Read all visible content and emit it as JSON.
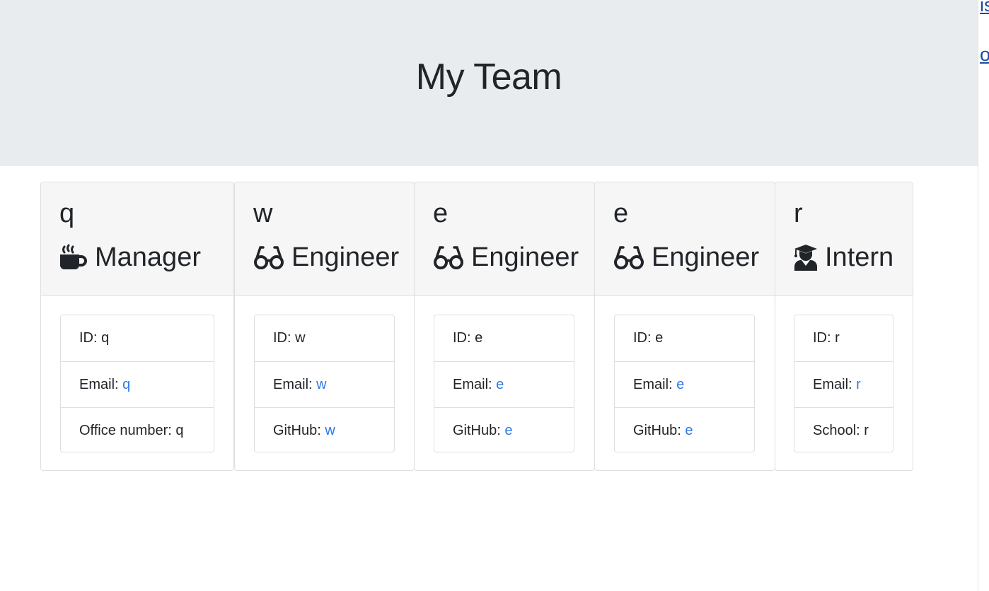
{
  "header": {
    "title": "My Team"
  },
  "right_strip": {
    "top_fragment": "is",
    "bottom_fragment": "or"
  },
  "colors": {
    "jumbotron_bg": "#e9ecef",
    "link": "#2f79e8",
    "card_header_bg": "#f6f6f6"
  },
  "cards": [
    {
      "name": "q",
      "role": "Manager",
      "role_icon": "mug-hot-icon",
      "id_label": "ID: ",
      "id": "q",
      "email_label": "Email: ",
      "email": "q",
      "extra_label": "Office number: ",
      "extra": "q",
      "extra_is_link": false
    },
    {
      "name": "w",
      "role": "Engineer",
      "role_icon": "glasses-icon",
      "id_label": "ID: ",
      "id": "w",
      "email_label": "Email: ",
      "email": "w",
      "extra_label": "GitHub: ",
      "extra": "w",
      "extra_is_link": true
    },
    {
      "name": "e",
      "role": "Engineer",
      "role_icon": "glasses-icon",
      "id_label": "ID: ",
      "id": "e",
      "email_label": "Email: ",
      "email": "e",
      "extra_label": "GitHub: ",
      "extra": "e",
      "extra_is_link": true
    },
    {
      "name": "e",
      "role": "Engineer",
      "role_icon": "glasses-icon",
      "id_label": "ID: ",
      "id": "e",
      "email_label": "Email: ",
      "email": "e",
      "extra_label": "GitHub: ",
      "extra": "e",
      "extra_is_link": true
    },
    {
      "name": "r",
      "role": "Intern",
      "role_icon": "user-graduate-icon",
      "id_label": "ID: ",
      "id": "r",
      "email_label": "Email: ",
      "email": "r",
      "extra_label": "School: ",
      "extra": "r",
      "extra_is_link": false
    }
  ]
}
